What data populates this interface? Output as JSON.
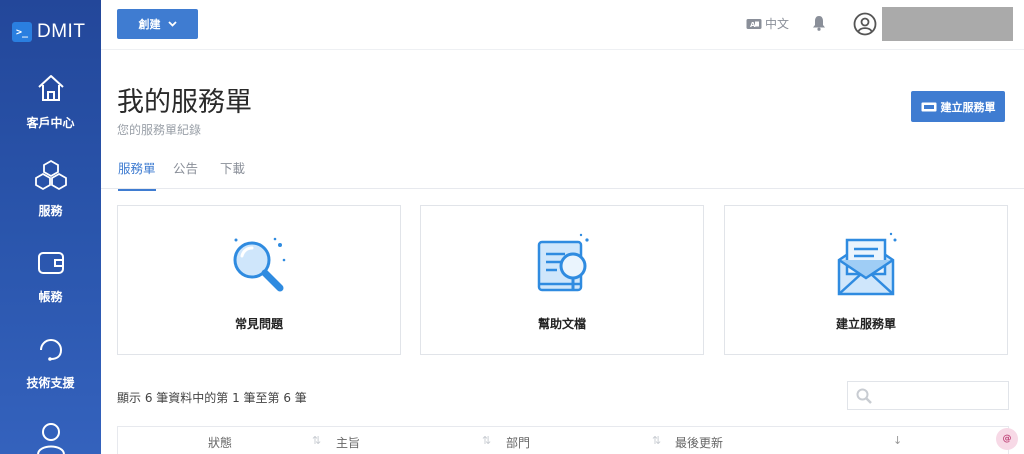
{
  "brand": {
    "name": "DMIT",
    "mark": ">_"
  },
  "sidebar": {
    "items": [
      {
        "label": "客戶中心",
        "icon": "home-icon"
      },
      {
        "label": "服務",
        "icon": "cubes-icon"
      },
      {
        "label": "帳務",
        "icon": "wallet-icon"
      },
      {
        "label": "技術支援",
        "icon": "headset-icon"
      },
      {
        "label": "",
        "icon": "users-icon"
      }
    ]
  },
  "topbar": {
    "create_label": "創建",
    "language_label": "中文",
    "bell_icon": "bell-icon",
    "user_icon": "user-circle-icon"
  },
  "page": {
    "title": "我的服務單",
    "subtitle": "您的服務單紀錄",
    "new_ticket_label": "建立服務單"
  },
  "tabs": [
    {
      "label": "服務單",
      "active": true
    },
    {
      "label": "公告",
      "active": false
    },
    {
      "label": "下載",
      "active": false
    }
  ],
  "cards": [
    {
      "label": "常見問題",
      "icon": "magnifier-icon"
    },
    {
      "label": "幫助文檔",
      "icon": "document-search-icon"
    },
    {
      "label": "建立服務單",
      "icon": "envelope-icon"
    }
  ],
  "table": {
    "info": "顯示 6 筆資料中的第 1 筆至第 6 筆",
    "search_placeholder": "",
    "columns": [
      "狀態",
      "主旨",
      "部門",
      "最後更新"
    ]
  },
  "floating_badge": "@",
  "colors": {
    "accent": "#3f7cd1",
    "sidebar": "#2a55ac",
    "icon_blue": "#2f8be0"
  }
}
